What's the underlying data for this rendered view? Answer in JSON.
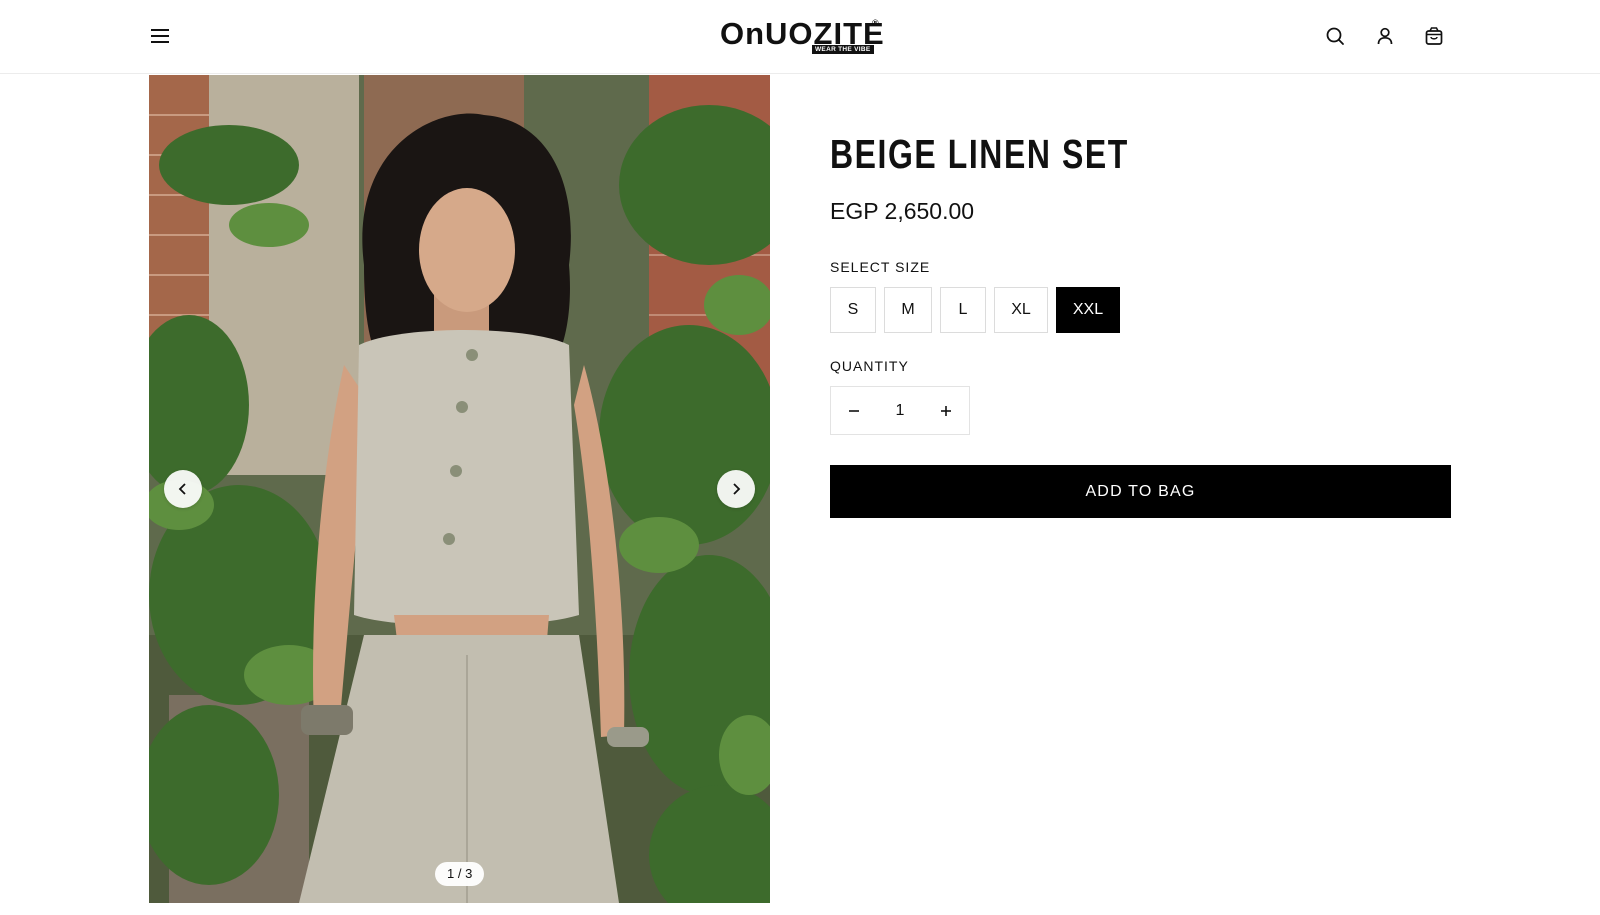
{
  "header": {
    "logo_text": "OnUOZITE",
    "logo_tagline": "WEAR THE VIBE",
    "logo_registered": "®",
    "icons": [
      "menu-icon",
      "search-icon",
      "account-icon",
      "cart-icon"
    ]
  },
  "gallery": {
    "counter": "1 / 3",
    "current_image": 1,
    "total_images": 3,
    "icons": [
      "chevron-left-icon",
      "chevron-right-icon"
    ]
  },
  "product": {
    "title": "BEIGE LINEN SET",
    "price": "EGP 2,650.00",
    "size_label": "SELECT SIZE",
    "sizes": [
      {
        "label": "S",
        "selected": false
      },
      {
        "label": "M",
        "selected": false
      },
      {
        "label": "L",
        "selected": false
      },
      {
        "label": "XL",
        "selected": false
      },
      {
        "label": "XXL",
        "selected": true
      }
    ],
    "quantity_label": "QUANTITY",
    "quantity": "1",
    "add_to_bag": "ADD TO BAG"
  },
  "colors": {
    "primary": "#000000",
    "background": "#ffffff",
    "border": "#dcdcdc"
  }
}
